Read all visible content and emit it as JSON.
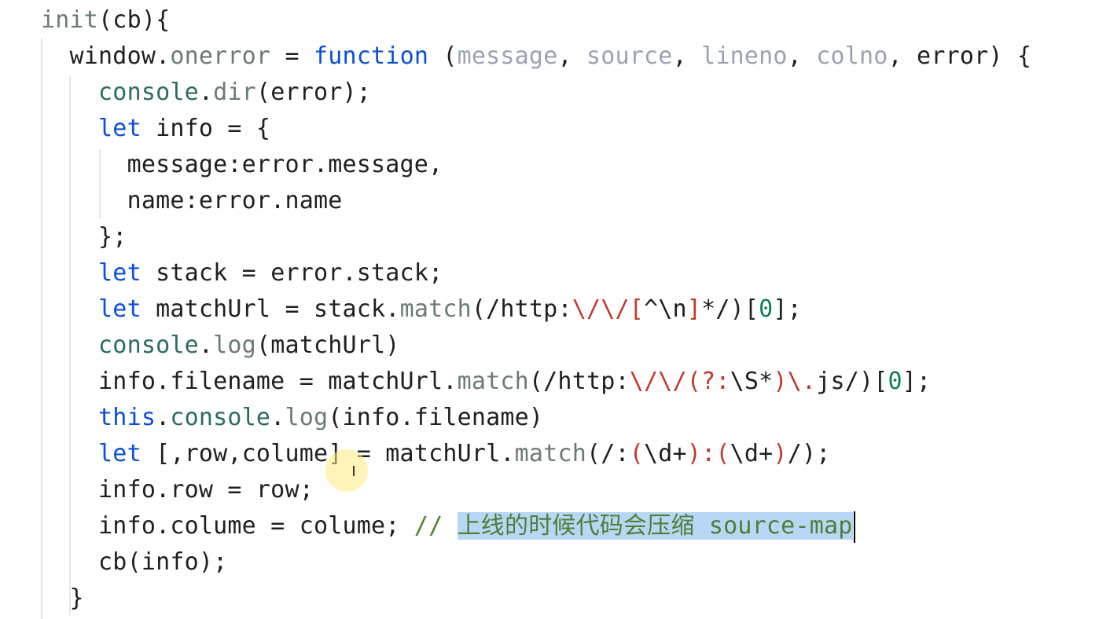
{
  "editor": {
    "lines": [
      {
        "tokens": [
          {
            "text": "init",
            "cls": "tk-func"
          },
          {
            "text": "(cb){",
            "cls": "tk-default"
          }
        ]
      },
      {
        "tokens": [
          {
            "text": "  window",
            "cls": "tk-default"
          },
          {
            "text": ".",
            "cls": "tk-default"
          },
          {
            "text": "onerror",
            "cls": "tk-func"
          },
          {
            "text": " = ",
            "cls": "tk-default"
          },
          {
            "text": "function",
            "cls": "tk-keyword"
          },
          {
            "text": " (",
            "cls": "tk-default"
          },
          {
            "text": "message",
            "cls": "tk-param"
          },
          {
            "text": ", ",
            "cls": "tk-default"
          },
          {
            "text": "source",
            "cls": "tk-param"
          },
          {
            "text": ", ",
            "cls": "tk-default"
          },
          {
            "text": "lineno",
            "cls": "tk-param"
          },
          {
            "text": ", ",
            "cls": "tk-default"
          },
          {
            "text": "colno",
            "cls": "tk-param"
          },
          {
            "text": ", error) {",
            "cls": "tk-default"
          }
        ]
      },
      {
        "tokens": [
          {
            "text": "    console",
            "cls": "tk-prop"
          },
          {
            "text": ".",
            "cls": "tk-default"
          },
          {
            "text": "dir",
            "cls": "tk-func"
          },
          {
            "text": "(error);",
            "cls": "tk-default"
          }
        ]
      },
      {
        "tokens": [
          {
            "text": "    ",
            "cls": "tk-default"
          },
          {
            "text": "let",
            "cls": "tk-keyword"
          },
          {
            "text": " info = {",
            "cls": "tk-default"
          }
        ]
      },
      {
        "tokens": [
          {
            "text": "      message:error.message,",
            "cls": "tk-default"
          }
        ]
      },
      {
        "tokens": [
          {
            "text": "      name:error.name",
            "cls": "tk-default"
          }
        ]
      },
      {
        "tokens": [
          {
            "text": "    };",
            "cls": "tk-default"
          }
        ]
      },
      {
        "tokens": [
          {
            "text": "    ",
            "cls": "tk-default"
          },
          {
            "text": "let",
            "cls": "tk-keyword"
          },
          {
            "text": " stack = error.stack;",
            "cls": "tk-default"
          }
        ]
      },
      {
        "tokens": [
          {
            "text": "    ",
            "cls": "tk-default"
          },
          {
            "text": "let",
            "cls": "tk-keyword"
          },
          {
            "text": " matchUrl = stack.",
            "cls": "tk-default"
          },
          {
            "text": "match",
            "cls": "tk-func"
          },
          {
            "text": "(/http:",
            "cls": "tk-default"
          },
          {
            "text": "\\/\\/[",
            "cls": "tk-string"
          },
          {
            "text": "^\\n",
            "cls": "tk-default"
          },
          {
            "text": "]",
            "cls": "tk-string"
          },
          {
            "text": "*/)[",
            "cls": "tk-default"
          },
          {
            "text": "0",
            "cls": "tk-number"
          },
          {
            "text": "];",
            "cls": "tk-default"
          }
        ]
      },
      {
        "tokens": [
          {
            "text": "    console",
            "cls": "tk-prop"
          },
          {
            "text": ".",
            "cls": "tk-default"
          },
          {
            "text": "log",
            "cls": "tk-func"
          },
          {
            "text": "(matchUrl)",
            "cls": "tk-default"
          }
        ]
      },
      {
        "tokens": [
          {
            "text": "    info.filename = matchUrl.",
            "cls": "tk-default"
          },
          {
            "text": "match",
            "cls": "tk-func"
          },
          {
            "text": "(/http:",
            "cls": "tk-default"
          },
          {
            "text": "\\/\\/(?:",
            "cls": "tk-string"
          },
          {
            "text": "\\S*",
            "cls": "tk-default"
          },
          {
            "text": ")\\.",
            "cls": "tk-string"
          },
          {
            "text": "js/)[",
            "cls": "tk-default"
          },
          {
            "text": "0",
            "cls": "tk-number"
          },
          {
            "text": "];",
            "cls": "tk-default"
          }
        ]
      },
      {
        "tokens": [
          {
            "text": "    ",
            "cls": "tk-default"
          },
          {
            "text": "this",
            "cls": "tk-this"
          },
          {
            "text": ".",
            "cls": "tk-default"
          },
          {
            "text": "console",
            "cls": "tk-prop"
          },
          {
            "text": ".",
            "cls": "tk-default"
          },
          {
            "text": "log",
            "cls": "tk-func"
          },
          {
            "text": "(info.filename)",
            "cls": "tk-default"
          }
        ]
      },
      {
        "tokens": [
          {
            "text": "    ",
            "cls": "tk-default"
          },
          {
            "text": "let",
            "cls": "tk-keyword"
          },
          {
            "text": " [,row,colume] = matchUrl.",
            "cls": "tk-default"
          },
          {
            "text": "match",
            "cls": "tk-func"
          },
          {
            "text": "(/:",
            "cls": "tk-default"
          },
          {
            "text": "(",
            "cls": "tk-string"
          },
          {
            "text": "\\d+",
            "cls": "tk-default"
          },
          {
            "text": "):(",
            "cls": "tk-string"
          },
          {
            "text": "\\d+",
            "cls": "tk-default"
          },
          {
            "text": ")",
            "cls": "tk-string"
          },
          {
            "text": "/);",
            "cls": "tk-default"
          }
        ]
      },
      {
        "tokens": [
          {
            "text": "    info.row = row;",
            "cls": "tk-default"
          }
        ]
      },
      {
        "tokens": [
          {
            "text": "    info.colume = colume; ",
            "cls": "tk-default"
          },
          {
            "text": "// ",
            "cls": "tk-comment"
          },
          {
            "text": "上线的时候代码会压缩 source-map",
            "cls": "tk-comment selection"
          }
        ]
      },
      {
        "tokens": [
          {
            "text": "    cb(info);",
            "cls": "tk-default"
          }
        ]
      },
      {
        "tokens": [
          {
            "text": "  }",
            "cls": "tk-default"
          }
        ]
      }
    ]
  },
  "mouse": {
    "cursor_glyph": "I"
  }
}
